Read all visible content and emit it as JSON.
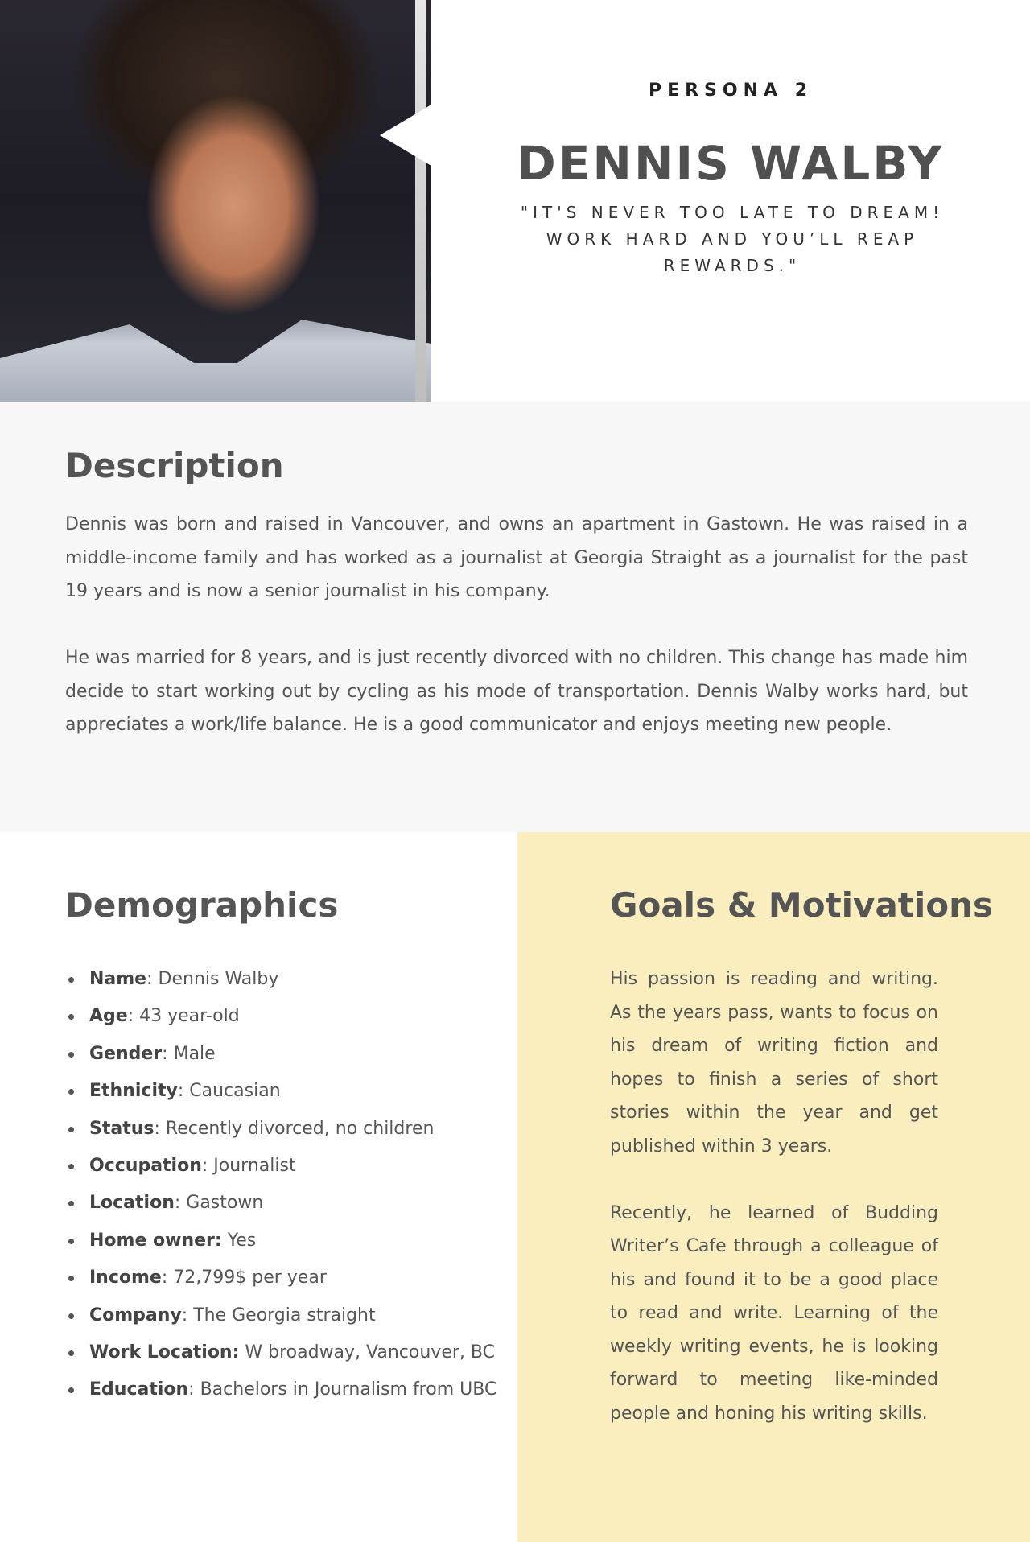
{
  "header": {
    "persona_label": "PERSONA 2",
    "name": "DENNIS WALBY",
    "quote": "\"IT'S NEVER TOO LATE TO DREAM! WORK HARD AND YOU’LL REAP REWARDS.\""
  },
  "description": {
    "title": "Description",
    "paragraphs": [
      "Dennis was born and raised in Vancouver, and owns an apartment in Gastown. He was raised in a middle-income family and has worked as a journalist at Georgia Straight as a journalist for the past 19 years and is now a senior journalist in his company.",
      "He was married for 8 years, and is just recently divorced with no children. This change has made him decide to start working out by cycling as his mode of transportation. Dennis Walby works hard, but appreciates a work/life balance. He is a good communicator and enjoys meeting new people."
    ]
  },
  "demographics": {
    "title": "Demographics",
    "items": [
      {
        "label": "Name",
        "sep": ":",
        "value": " Dennis Walby"
      },
      {
        "label": "Age",
        "sep": ":",
        "value": " 43 year-old"
      },
      {
        "label": "Gender",
        "sep": ":",
        "value": " Male"
      },
      {
        "label": "Ethnicity",
        "sep": ":",
        "value": " Caucasian"
      },
      {
        "label": "Status",
        "sep": ":",
        "value": " Recently divorced, no children"
      },
      {
        "label": "Occupation",
        "sep": ":",
        "value": " Journalist"
      },
      {
        "label": "Location",
        "sep": ":",
        "value": " Gastown"
      },
      {
        "label": "Home owner:",
        "sep": "",
        "value": " Yes"
      },
      {
        "label": "Income",
        "sep": ":",
        "value": " 72,799$ per year"
      },
      {
        "label": "Company",
        "sep": ":",
        "value": " The Georgia straight"
      },
      {
        "label": "Work Location:",
        "sep": "",
        "value": " W broadway, Vancouver, BC"
      },
      {
        "label": "Education",
        "sep": ":",
        "value": " Bachelors in Journalism from UBC"
      }
    ]
  },
  "goals": {
    "title": "Goals & Motivations",
    "paragraphs": [
      "His passion is reading and writing. As the years pass, wants to focus on his dream of writing fiction and hopes to finish a series of short stories within the year and get published within 3 years.",
      "Recently, he learned of Budding Writer’s Cafe through a colleague of his and found it to be a good place to read and write. Learning of the weekly writing events, he is looking forward to meeting like-minded people and honing his writing skills."
    ]
  },
  "colors": {
    "description_bg": "#f7f7f7",
    "goals_bg": "#fbeebe",
    "heading": "#555555"
  }
}
